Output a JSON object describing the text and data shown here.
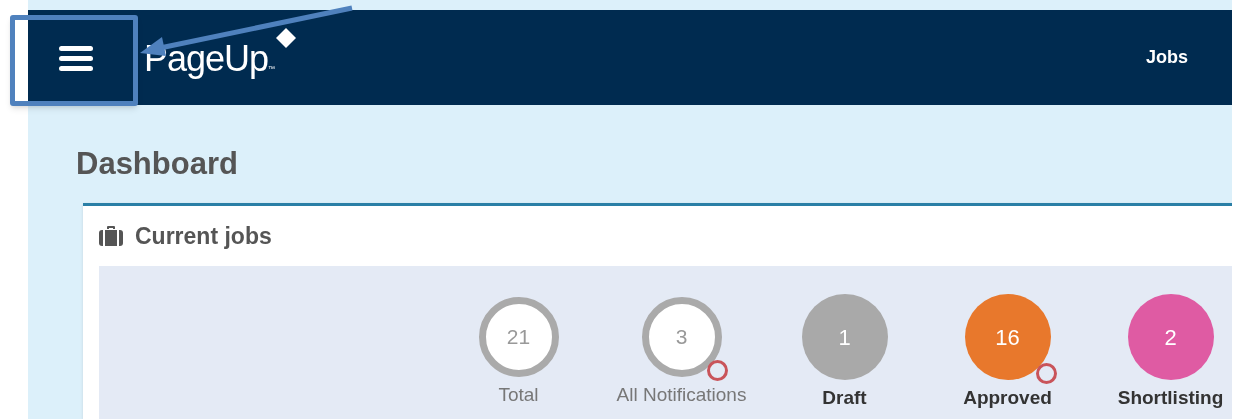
{
  "header": {
    "logo": {
      "text": "PageUp",
      "mark": "™"
    },
    "nav": [
      {
        "label": "Jobs"
      }
    ]
  },
  "page": {
    "title": "Dashboard"
  },
  "card": {
    "title": "Current jobs",
    "statuses": [
      {
        "count": "21",
        "label": "Total",
        "kind": "outline",
        "color": "#aaaaaa",
        "alert": false
      },
      {
        "count": "3",
        "label": "All Notifications",
        "kind": "outline",
        "color": "#aaaaaa",
        "alert": true
      },
      {
        "count": "1",
        "label": "Draft",
        "kind": "filled",
        "color": "#a9a9a9",
        "alert": false
      },
      {
        "count": "16",
        "label": "Approved",
        "kind": "filled",
        "color": "#e8782c",
        "alert": true
      },
      {
        "count": "2",
        "label": "Shortlisting",
        "kind": "filled",
        "color": "#df5ba3",
        "alert": false
      }
    ]
  },
  "annotation": {
    "kind": "callout"
  }
}
